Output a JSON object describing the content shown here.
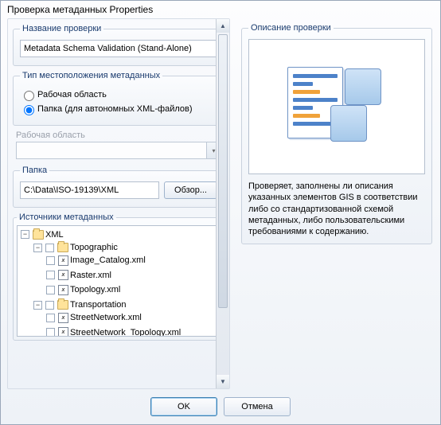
{
  "window": {
    "title": "Проверка метаданных Properties"
  },
  "name_section": {
    "legend": "Название проверки",
    "value": "Metadata Schema Validation (Stand-Alone)"
  },
  "location_type": {
    "legend": "Тип местоположения метаданных",
    "option_workspace": "Рабочая область",
    "option_folder": "Папка (для автономных XML-файлов)",
    "selected": "folder"
  },
  "workspace": {
    "label": "Рабочая область",
    "value": ""
  },
  "folder": {
    "legend": "Папка",
    "value": "C:\\Data\\ISO-19139\\XML",
    "browse": "Обзор..."
  },
  "sources": {
    "legend": "Источники метаданных",
    "tree": {
      "root": "XML",
      "childA": {
        "name": "Topographic",
        "files": [
          "Image_Catalog.xml",
          "Raster.xml",
          "Topology.xml"
        ]
      },
      "childB": {
        "name": "Transportation",
        "files": [
          "StreetNetwork.xml",
          "StreetNetwork_Topology.xml"
        ]
      }
    }
  },
  "description": {
    "legend": "Описание проверки",
    "text": "Проверяет, заполнены ли описания указанных элементов GIS в соответствии либо со стандартизованной схемой метаданных, либо пользовательскими требованиями к содержанию."
  },
  "footer": {
    "ok": "OK",
    "cancel": "Отмена"
  }
}
